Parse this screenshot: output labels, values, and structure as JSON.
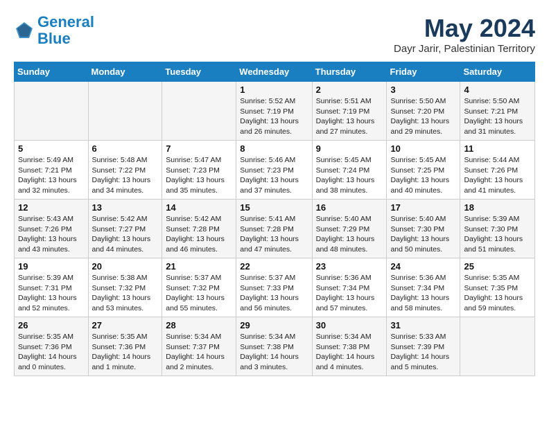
{
  "header": {
    "logo_line1": "General",
    "logo_line2": "Blue",
    "month_title": "May 2024",
    "location": "Dayr Jarir, Palestinian Territory"
  },
  "days_of_week": [
    "Sunday",
    "Monday",
    "Tuesday",
    "Wednesday",
    "Thursday",
    "Friday",
    "Saturday"
  ],
  "weeks": [
    [
      {
        "day": "",
        "info": ""
      },
      {
        "day": "",
        "info": ""
      },
      {
        "day": "",
        "info": ""
      },
      {
        "day": "1",
        "info": "Sunrise: 5:52 AM\nSunset: 7:19 PM\nDaylight: 13 hours\nand 26 minutes."
      },
      {
        "day": "2",
        "info": "Sunrise: 5:51 AM\nSunset: 7:19 PM\nDaylight: 13 hours\nand 27 minutes."
      },
      {
        "day": "3",
        "info": "Sunrise: 5:50 AM\nSunset: 7:20 PM\nDaylight: 13 hours\nand 29 minutes."
      },
      {
        "day": "4",
        "info": "Sunrise: 5:50 AM\nSunset: 7:21 PM\nDaylight: 13 hours\nand 31 minutes."
      }
    ],
    [
      {
        "day": "5",
        "info": "Sunrise: 5:49 AM\nSunset: 7:21 PM\nDaylight: 13 hours\nand 32 minutes."
      },
      {
        "day": "6",
        "info": "Sunrise: 5:48 AM\nSunset: 7:22 PM\nDaylight: 13 hours\nand 34 minutes."
      },
      {
        "day": "7",
        "info": "Sunrise: 5:47 AM\nSunset: 7:23 PM\nDaylight: 13 hours\nand 35 minutes."
      },
      {
        "day": "8",
        "info": "Sunrise: 5:46 AM\nSunset: 7:23 PM\nDaylight: 13 hours\nand 37 minutes."
      },
      {
        "day": "9",
        "info": "Sunrise: 5:45 AM\nSunset: 7:24 PM\nDaylight: 13 hours\nand 38 minutes."
      },
      {
        "day": "10",
        "info": "Sunrise: 5:45 AM\nSunset: 7:25 PM\nDaylight: 13 hours\nand 40 minutes."
      },
      {
        "day": "11",
        "info": "Sunrise: 5:44 AM\nSunset: 7:26 PM\nDaylight: 13 hours\nand 41 minutes."
      }
    ],
    [
      {
        "day": "12",
        "info": "Sunrise: 5:43 AM\nSunset: 7:26 PM\nDaylight: 13 hours\nand 43 minutes."
      },
      {
        "day": "13",
        "info": "Sunrise: 5:42 AM\nSunset: 7:27 PM\nDaylight: 13 hours\nand 44 minutes."
      },
      {
        "day": "14",
        "info": "Sunrise: 5:42 AM\nSunset: 7:28 PM\nDaylight: 13 hours\nand 46 minutes."
      },
      {
        "day": "15",
        "info": "Sunrise: 5:41 AM\nSunset: 7:28 PM\nDaylight: 13 hours\nand 47 minutes."
      },
      {
        "day": "16",
        "info": "Sunrise: 5:40 AM\nSunset: 7:29 PM\nDaylight: 13 hours\nand 48 minutes."
      },
      {
        "day": "17",
        "info": "Sunrise: 5:40 AM\nSunset: 7:30 PM\nDaylight: 13 hours\nand 50 minutes."
      },
      {
        "day": "18",
        "info": "Sunrise: 5:39 AM\nSunset: 7:30 PM\nDaylight: 13 hours\nand 51 minutes."
      }
    ],
    [
      {
        "day": "19",
        "info": "Sunrise: 5:39 AM\nSunset: 7:31 PM\nDaylight: 13 hours\nand 52 minutes."
      },
      {
        "day": "20",
        "info": "Sunrise: 5:38 AM\nSunset: 7:32 PM\nDaylight: 13 hours\nand 53 minutes."
      },
      {
        "day": "21",
        "info": "Sunrise: 5:37 AM\nSunset: 7:32 PM\nDaylight: 13 hours\nand 55 minutes."
      },
      {
        "day": "22",
        "info": "Sunrise: 5:37 AM\nSunset: 7:33 PM\nDaylight: 13 hours\nand 56 minutes."
      },
      {
        "day": "23",
        "info": "Sunrise: 5:36 AM\nSunset: 7:34 PM\nDaylight: 13 hours\nand 57 minutes."
      },
      {
        "day": "24",
        "info": "Sunrise: 5:36 AM\nSunset: 7:34 PM\nDaylight: 13 hours\nand 58 minutes."
      },
      {
        "day": "25",
        "info": "Sunrise: 5:35 AM\nSunset: 7:35 PM\nDaylight: 13 hours\nand 59 minutes."
      }
    ],
    [
      {
        "day": "26",
        "info": "Sunrise: 5:35 AM\nSunset: 7:36 PM\nDaylight: 14 hours\nand 0 minutes."
      },
      {
        "day": "27",
        "info": "Sunrise: 5:35 AM\nSunset: 7:36 PM\nDaylight: 14 hours\nand 1 minute."
      },
      {
        "day": "28",
        "info": "Sunrise: 5:34 AM\nSunset: 7:37 PM\nDaylight: 14 hours\nand 2 minutes."
      },
      {
        "day": "29",
        "info": "Sunrise: 5:34 AM\nSunset: 7:38 PM\nDaylight: 14 hours\nand 3 minutes."
      },
      {
        "day": "30",
        "info": "Sunrise: 5:34 AM\nSunset: 7:38 PM\nDaylight: 14 hours\nand 4 minutes."
      },
      {
        "day": "31",
        "info": "Sunrise: 5:33 AM\nSunset: 7:39 PM\nDaylight: 14 hours\nand 5 minutes."
      },
      {
        "day": "",
        "info": ""
      }
    ]
  ]
}
